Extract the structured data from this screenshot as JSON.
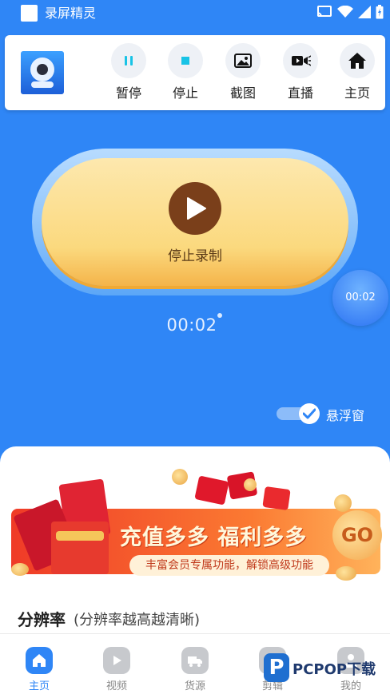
{
  "status_bar": {
    "app_title": "录屏精灵",
    "icons": [
      "cast-icon",
      "wifi-icon",
      "signal-icon",
      "battery-icon"
    ]
  },
  "toolbar": {
    "logo": "app-logo-camera",
    "tools": [
      {
        "label": "暂停",
        "icon": "pause-icon"
      },
      {
        "label": "停止",
        "icon": "stop-icon"
      },
      {
        "label": "截图",
        "icon": "image-icon"
      },
      {
        "label": "直播",
        "icon": "live-icon"
      },
      {
        "label": "主页",
        "icon": "home-icon"
      }
    ]
  },
  "record": {
    "label": "停止录制",
    "icon": "play-icon"
  },
  "timer": "00:02",
  "float_bubble": "00:02",
  "float_window": {
    "label": "悬浮窗",
    "checked": true
  },
  "banner": {
    "title": "充值多多 福利多多",
    "subtitle": "丰富会员专属功能，解锁高级功能",
    "go": "GO"
  },
  "resolution": {
    "title": "分辨率",
    "hint": "(分辨率越高越清晰)"
  },
  "tabbar": {
    "active": 0,
    "items": [
      {
        "label": "主页",
        "icon": "home-icon"
      },
      {
        "label": "视频",
        "icon": "video-icon"
      },
      {
        "label": "货源",
        "icon": "truck-icon"
      },
      {
        "label": "剪辑",
        "icon": "scissors-icon"
      },
      {
        "label": "我的",
        "icon": "user-icon"
      }
    ]
  },
  "watermark": {
    "letter": "P",
    "text": "PCPOP下载"
  },
  "colors": {
    "primary": "#2f86f6",
    "record_button": "#fbd97e",
    "play_circle": "#7a3f1a"
  }
}
